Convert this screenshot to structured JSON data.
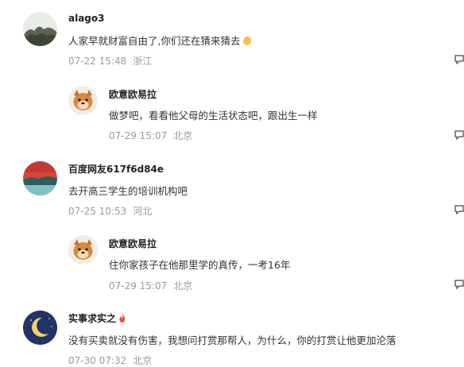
{
  "comments": [
    {
      "user": "alago3",
      "text": "人家早就财富自由了,你们还在猜来猜去",
      "date": "07-22 15:48",
      "location": "浙江",
      "emoji": "clapping-hands-icon"
    },
    {
      "user": "欧意欧易拉",
      "text": "做梦吧，看看他父母的生活状态吧，跟出生一样",
      "date": "07-29 15:07",
      "location": "北京"
    },
    {
      "user": "百度网友617f6d84e",
      "text": "去开高三学生的培训机构吧",
      "date": "07-25 10:53",
      "location": "河北"
    },
    {
      "user": "欧意欧易拉",
      "text": "住你家孩子在他那里学的真传，一考16年",
      "date": "07-29 15:07",
      "location": "北京"
    },
    {
      "user": "实事求实之",
      "text": "没有买卖就没有伤害，我想问打赏那帮人，为什么，你的打赏让他更加沦落",
      "date": "07-30 07:32",
      "location": "北京",
      "badge": "fire-icon"
    }
  ]
}
